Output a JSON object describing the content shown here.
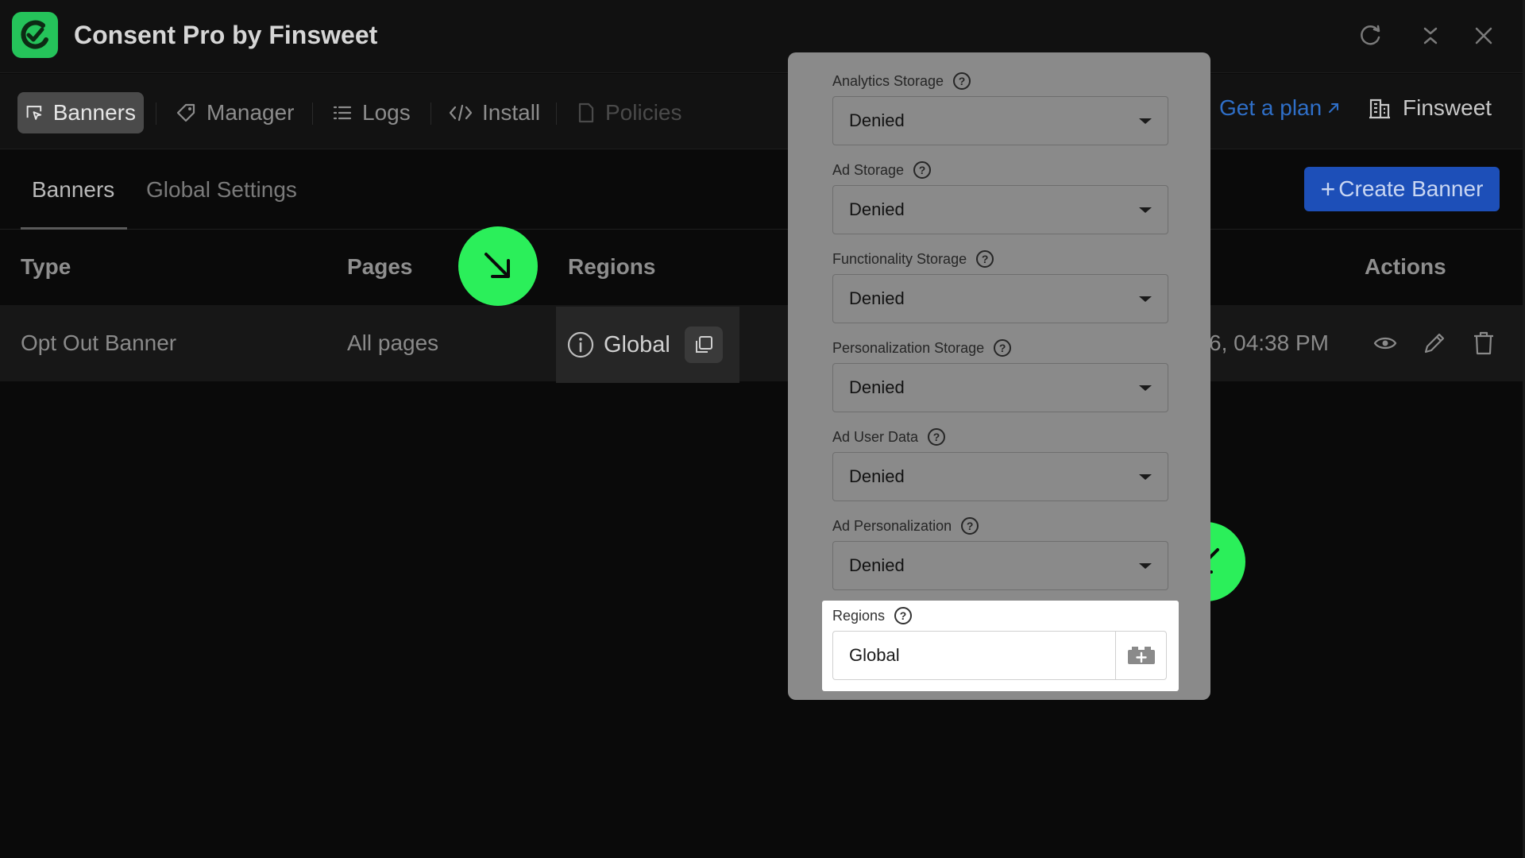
{
  "app": {
    "title": "Consent Pro by Finsweet",
    "brand_color": "#25c35a"
  },
  "nav": {
    "items": [
      {
        "label": "Banners",
        "icon": "banner-icon",
        "state": "active"
      },
      {
        "label": "Manager",
        "icon": "tag-icon",
        "state": "normal"
      },
      {
        "label": "Logs",
        "icon": "list-icon",
        "state": "normal"
      },
      {
        "label": "Install",
        "icon": "code-icon",
        "state": "normal"
      },
      {
        "label": "Policies",
        "icon": "document-icon",
        "state": "disabled"
      }
    ],
    "get_plan": "Get a plan",
    "workspace": "Finsweet"
  },
  "subtabs": {
    "banners": "Banners",
    "global_settings": "Global Settings"
  },
  "create_button": "Create Banner",
  "table": {
    "headers": {
      "type": "Type",
      "pages": "Pages",
      "regions": "Regions",
      "actions": "Actions"
    },
    "rows": [
      {
        "type": "Opt Out Banner",
        "pages": "All pages",
        "regions": "Global",
        "date": "6, 04:38 PM"
      }
    ]
  },
  "panel": {
    "fields": [
      {
        "label": "Analytics Storage",
        "value": "Denied"
      },
      {
        "label": "Ad Storage",
        "value": "Denied"
      },
      {
        "label": "Functionality Storage",
        "value": "Denied"
      },
      {
        "label": "Personalization Storage",
        "value": "Denied"
      },
      {
        "label": "Ad User Data",
        "value": "Denied"
      },
      {
        "label": "Ad Personalization",
        "value": "Denied"
      }
    ],
    "regions": {
      "label": "Regions",
      "value": "Global"
    }
  },
  "colors": {
    "accent_blue": "#1d4fb8",
    "marker_green": "#2bef5a"
  }
}
